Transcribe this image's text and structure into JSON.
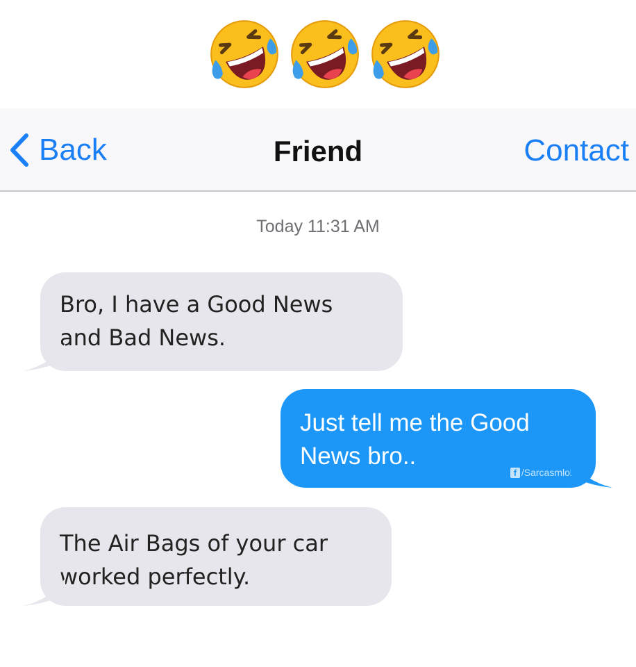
{
  "emojis": [
    {
      "icon": "rolling-on-floor-laughing-emoji"
    },
    {
      "icon": "rolling-on-floor-laughing-emoji"
    },
    {
      "icon": "rolling-on-floor-laughing-emoji"
    }
  ],
  "navbar": {
    "back_label": "Back",
    "title": "Friend",
    "contact_label": "Contact",
    "back_icon": "chevron-left-icon"
  },
  "timestamp": "Today 11:31 AM",
  "messages": [
    {
      "direction": "incoming",
      "lines": [
        "Bro, I have a Good News",
        "and Bad News."
      ]
    },
    {
      "direction": "outgoing",
      "lines": [
        "Just tell me the Good",
        "News bro.."
      ]
    },
    {
      "direction": "incoming",
      "lines": [
        "The Air Bags of your car",
        "worked perfectly."
      ]
    }
  ],
  "watermark": {
    "icon": "facebook-icon",
    "icon_glyph": "f",
    "text": "/Sarcasmlol"
  },
  "colors": {
    "accent": "#1a7ff5",
    "outgoing_bubble": "#1c97f8",
    "incoming_bubble": "#e6e6ec",
    "emoji_face": "#fbbf1d"
  }
}
